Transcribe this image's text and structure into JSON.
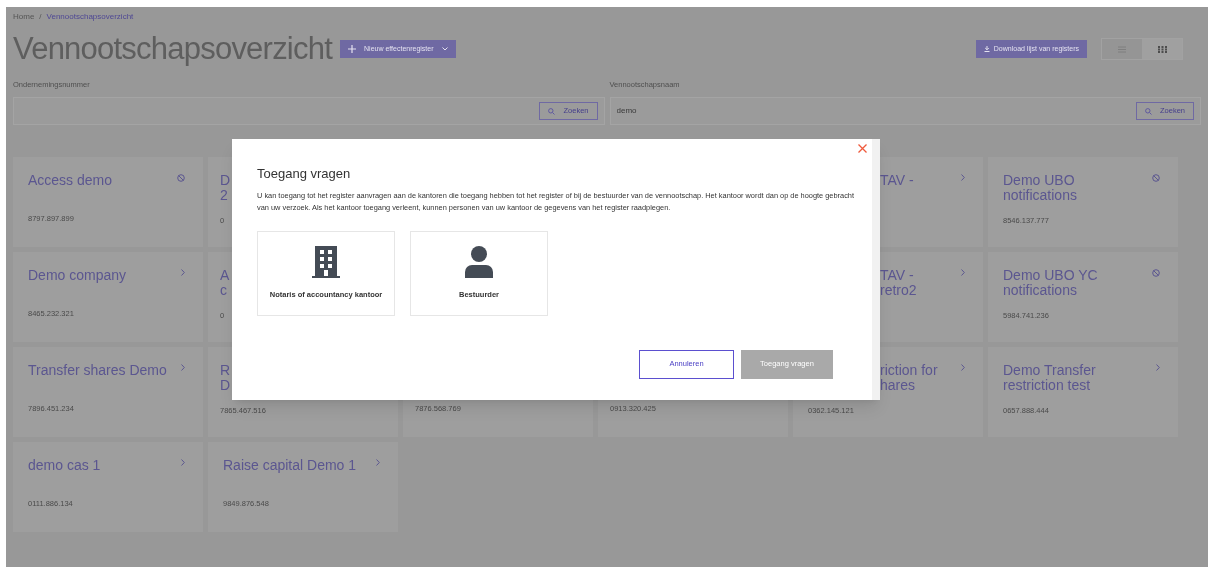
{
  "breadcrumb": [
    {
      "label": "Home",
      "current": false
    },
    {
      "label": "Vennootschapsoverzicht",
      "current": true
    }
  ],
  "breadcrumb_separator": "/",
  "page_title": "Vennootschapsoverzicht",
  "new_button": {
    "label": "Nieuw effectenregister"
  },
  "download_button": {
    "label": "Download lijst van registers"
  },
  "view_toggle": [
    {
      "kind": "list",
      "selected": false
    },
    {
      "kind": "grid",
      "selected": true
    }
  ],
  "filters": [
    {
      "label": "Ondernemingsnummer",
      "button": "Zoeken"
    },
    {
      "label": "Vennootschapsnaam",
      "value": "demo",
      "button": "Zoeken"
    }
  ],
  "cards": [
    {
      "kind": "full",
      "title_lines": [
        "Access demo"
      ],
      "number": "8797.897.899",
      "has_access": false
    },
    {
      "kind": "covered_left",
      "title_lines": [
        "D",
        "2"
      ],
      "number": "0"
    },
    {
      "kind": "hidden"
    },
    {
      "kind": "hidden"
    },
    {
      "kind": "covered_right",
      "title_lines": [
        "TAV -"
      ],
      "has_access": true
    },
    {
      "kind": "full",
      "title_lines": [
        "Demo UBO",
        "notifications"
      ],
      "number": "8546.137.777",
      "has_access": false
    },
    {
      "kind": "full",
      "title_lines": [
        "Demo company"
      ],
      "number": "8465.232.321",
      "has_access": true
    },
    {
      "kind": "covered_left",
      "title_lines": [
        "A",
        "c"
      ],
      "number": "0"
    },
    {
      "kind": "hidden"
    },
    {
      "kind": "hidden"
    },
    {
      "kind": "covered_right",
      "title_lines": [
        "TAV -",
        "retro2"
      ],
      "has_access": true
    },
    {
      "kind": "full",
      "title_lines": [
        "Demo UBO YC",
        "notifications"
      ],
      "number": "5984.741.236",
      "has_access": false
    },
    {
      "kind": "full",
      "title_lines": [
        "Transfer shares Demo"
      ],
      "number": "7896.451.234",
      "has_access": true
    },
    {
      "kind": "covered_left",
      "title_lines": [
        "R",
        "D"
      ],
      "number": "7865.467.516"
    },
    {
      "kind": "covered_left",
      "number": "7876.568.769"
    },
    {
      "kind": "covered_left",
      "number": "0913.320.425"
    },
    {
      "kind": "covered_right",
      "title_lines": [
        "riction for",
        "hares"
      ],
      "number": "0362.145.121",
      "has_access": true
    },
    {
      "kind": "full",
      "title_lines": [
        "Demo Transfer",
        "restriction test"
      ],
      "number": "0657.888.444",
      "has_access": true
    },
    {
      "kind": "full",
      "title_lines": [
        "demo cas 1"
      ],
      "number": "0111.886.134",
      "has_access": true
    },
    {
      "kind": "full",
      "title_lines": [
        "Raise capital Demo 1"
      ],
      "number": "9849.876.548",
      "has_access": true
    }
  ],
  "modal": {
    "title": "Toegang vragen",
    "text": "U kan toegang tot het register aanvragen aan de kantoren die toegang hebben tot het register of bij de bestuurder van de vennootschap. Het kantoor wordt dan op de hoogte gebracht van uw verzoek. Als het kantoor toegang verleent, kunnen personen van uw kantoor de gegevens van het register raadplegen.",
    "options": [
      {
        "kind": "office",
        "label": "Notaris of accountancy kantoor",
        "selected": false
      },
      {
        "kind": "person",
        "label": "Bestuurder",
        "selected": false
      }
    ],
    "cancel": {
      "label": "Annuleren"
    },
    "submit": {
      "label": "Toegang vragen",
      "disabled": true
    }
  }
}
